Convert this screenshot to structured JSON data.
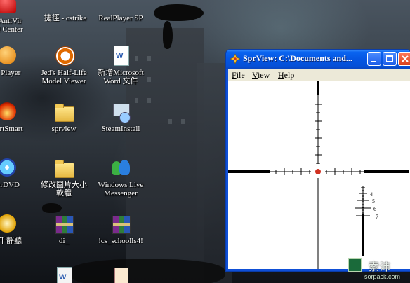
{
  "desktop": {
    "icons": [
      {
        "id": "antivir",
        "label_lines": [
          "ra AntiVir",
          "trol Center"
        ]
      },
      {
        "id": "cstrike",
        "label_lines": [
          "捷徑 - cstrike"
        ]
      },
      {
        "id": "realplayer",
        "label_lines": [
          "RealPlayer SP"
        ]
      },
      {
        "id": "mplayer",
        "label_lines": [
          "M Player"
        ]
      },
      {
        "id": "hlmv",
        "label_lines": [
          "Jed's Half-Life",
          "Model Viewer"
        ]
      },
      {
        "id": "worddoc",
        "label_lines": [
          "新增Microsoft",
          "Word 文件"
        ]
      },
      {
        "id": "startsmart",
        "label_lines": [
          "StartSmart"
        ]
      },
      {
        "id": "sprview",
        "label_lines": [
          "sprview"
        ]
      },
      {
        "id": "steaminstall",
        "label_lines": [
          "SteamInstall"
        ]
      },
      {
        "id": "powerdvd",
        "label_lines": [
          "verDVD"
        ]
      },
      {
        "id": "folder2",
        "label_lines": [
          "修改圖片大小",
          "軟體"
        ]
      },
      {
        "id": "messenger",
        "label_lines": [
          "Windows Live",
          "Messenger"
        ]
      },
      {
        "id": "qianqian",
        "label_lines": [
          "千千靜聽"
        ]
      },
      {
        "id": "di",
        "label_lines": [
          "di_"
        ]
      },
      {
        "id": "cs",
        "label_lines": [
          "!cs_schoolls4!"
        ]
      }
    ]
  },
  "window": {
    "title": "SprView: C:\\Documents and...",
    "menus": [
      "File",
      "View",
      "Help"
    ],
    "reticle_labels": [
      "4",
      "5",
      "6",
      "7"
    ],
    "reticle_color": "#000000",
    "center_dot_color": "#d03020"
  },
  "watermark": {
    "text": "索沛",
    "url": "sorpack.com"
  },
  "colors": {
    "titlebar": "#0556e3",
    "close": "#d8401c",
    "menubar": "#ece9d8"
  }
}
